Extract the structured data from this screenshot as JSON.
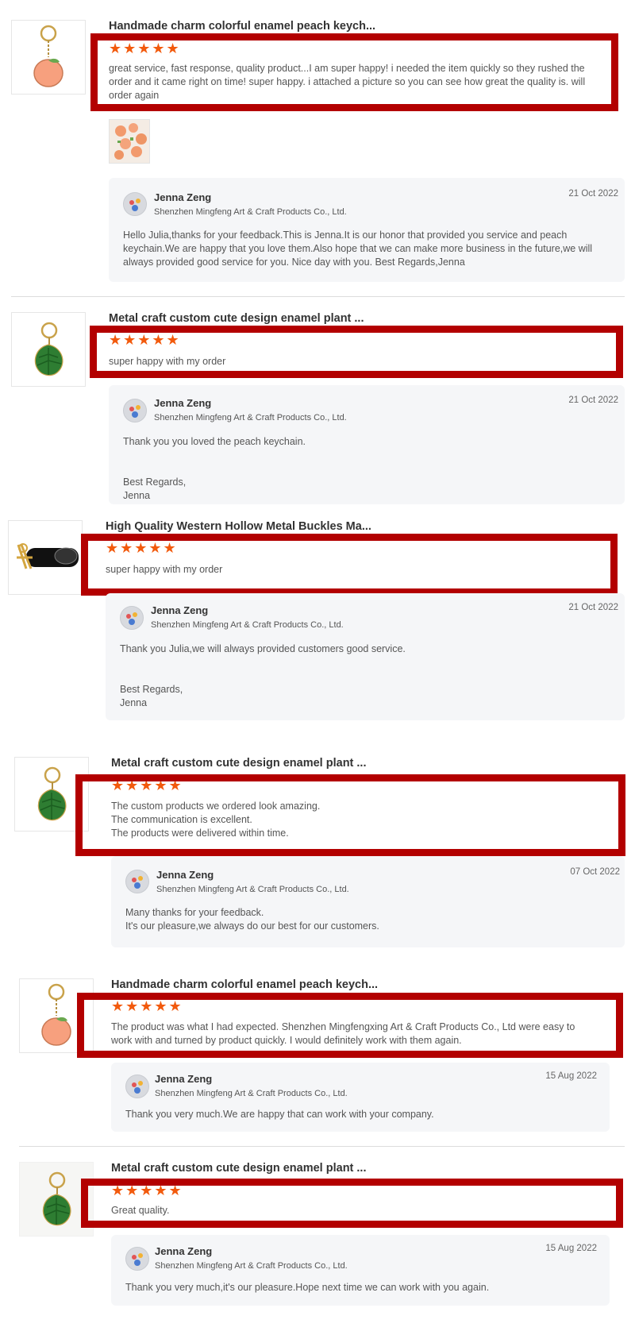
{
  "star_icon": "star-icon",
  "colors": {
    "star": "#f25a0d",
    "highlight_box": "#b30000",
    "reply_bg": "#f5f6f8"
  },
  "reviews": [
    {
      "product_title": "Handmade charm colorful enamel peach keych...",
      "stars": "★★★★★",
      "rating": 5,
      "text": "great service, fast response, quality product...I am super happy! i needed the item quickly so they rushed the order and it came right on time! super happy. i attached a picture so you can see how great the quality is. will order again",
      "reply": {
        "name": "Jenna Zeng",
        "company": "Shenzhen Mingfeng Art & Craft Products Co., Ltd.",
        "date": "21 Oct 2022",
        "text": "Hello Julia,thanks for your feedback.This is Jenna.It is our honor that provided you service and peach keychain.We are happy that you love them.Also hope that we can make more business in the future,we will always provided good service for you. Nice day with you. Best Regards,Jenna"
      }
    },
    {
      "product_title": "Metal craft custom cute design enamel plant ...",
      "stars": "★★★★★",
      "rating": 5,
      "text": "super happy with my order",
      "reply": {
        "name": "Jenna Zeng",
        "company": "Shenzhen Mingfeng Art & Craft Products Co., Ltd.",
        "date": "21 Oct 2022",
        "text": "Thank you you loved the peach keychain.\n\n\nBest Regards,\nJenna"
      }
    },
    {
      "product_title": "High Quality Western Hollow Metal Buckles Ma...",
      "stars": "★★★★★",
      "rating": 5,
      "text": "super happy with my order",
      "reply": {
        "name": "Jenna Zeng",
        "company": "Shenzhen Mingfeng Art & Craft Products Co., Ltd.",
        "date": "21 Oct 2022",
        "text": "Thank you Julia,we will always provided customers good service.\n\n\nBest Regards,\nJenna"
      }
    },
    {
      "product_title": "Metal craft custom cute design enamel plant ...",
      "stars": "★★★★★",
      "rating": 5,
      "text": "The custom products we ordered look amazing.\nThe communication is excellent.\nThe products were delivered within time.",
      "reply": {
        "name": "Jenna Zeng",
        "company": "Shenzhen Mingfeng Art & Craft Products Co., Ltd.",
        "date": "07 Oct 2022",
        "text": "Many thanks for your feedback.\nIt's our pleasure,we always do our best for our customers."
      }
    },
    {
      "product_title": "Handmade charm colorful enamel peach keych...",
      "stars": "★★★★★",
      "rating": 5,
      "text": "The product was what I had expected. Shenzhen Mingfengxing Art & Craft Products Co., Ltd were easy to work with and turned by product quickly. I would definitely work with them again.",
      "reply": {
        "name": "Jenna Zeng",
        "company": "Shenzhen Mingfeng Art & Craft Products Co., Ltd.",
        "date": "15 Aug 2022",
        "text": "Thank you very much.We are happy that can work with your company."
      }
    },
    {
      "product_title": "Metal craft custom cute design enamel plant ...",
      "stars": "★★★★★",
      "rating": 5,
      "text": "Great quality.",
      "reply": {
        "name": "Jenna Zeng",
        "company": "Shenzhen Mingfeng Art & Craft Products Co., Ltd.",
        "date": "15 Aug 2022",
        "text": "Thank you very much,it's our pleasure.Hope next time we can work with you again."
      }
    }
  ]
}
